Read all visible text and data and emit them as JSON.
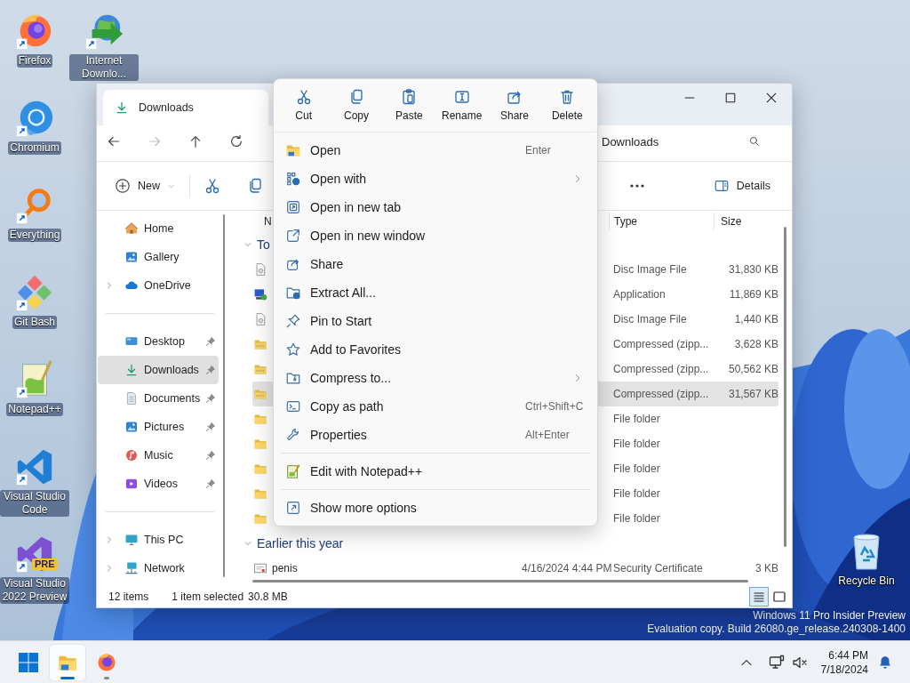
{
  "desktop": {
    "icons": [
      {
        "label": "Firefox"
      },
      {
        "label": "Chromium"
      },
      {
        "label": "Everything"
      },
      {
        "label": "Git Bash"
      },
      {
        "label": "Notepad++"
      },
      {
        "label": "Visual Studio Code"
      },
      {
        "label": "Visual Studio 2022 Preview",
        "badge": "PRE"
      },
      {
        "label": "Internet Downlo..."
      }
    ],
    "recycle_bin": {
      "label": "Recycle Bin"
    },
    "watermark": [
      "Windows 11 Pro Insider Preview",
      "Evaluation copy. Build 26080.ge_release.240308-1400"
    ]
  },
  "explorer": {
    "tab": {
      "title": "Downloads"
    },
    "navigation": [
      {
        "disabled": false
      },
      {
        "disabled": true
      },
      {
        "disabled": false
      },
      {
        "disabled": false
      }
    ],
    "address": "Downloads",
    "toolbar": {
      "new_label": "New",
      "details_label": "Details"
    },
    "sidebar": {
      "sections": [
        [
          {
            "label": "Home",
            "expandable": false,
            "pinned": false,
            "selected": false
          },
          {
            "label": "Gallery",
            "expandable": false,
            "pinned": false,
            "selected": false
          },
          {
            "label": "OneDrive",
            "expandable": true,
            "pinned": false,
            "selected": false
          }
        ],
        [
          {
            "label": "Desktop",
            "expandable": false,
            "pinned": true,
            "selected": false
          },
          {
            "label": "Downloads",
            "expandable": false,
            "pinned": true,
            "selected": true
          },
          {
            "label": "Documents",
            "expandable": false,
            "pinned": true,
            "selected": false
          },
          {
            "label": "Pictures",
            "expandable": false,
            "pinned": true,
            "selected": false
          },
          {
            "label": "Music",
            "expandable": false,
            "pinned": true,
            "selected": false
          },
          {
            "label": "Videos",
            "expandable": false,
            "pinned": true,
            "selected": false
          }
        ],
        [
          {
            "label": "This PC",
            "expandable": true,
            "pinned": false,
            "selected": false
          },
          {
            "label": "Network",
            "expandable": true,
            "pinned": false,
            "selected": false
          }
        ]
      ]
    },
    "columns": [
      {
        "label": "N"
      },
      {
        "label": "Type"
      },
      {
        "label": "Size"
      }
    ],
    "groups": [
      {
        "label": "To",
        "expanded": true,
        "rows": [
          {
            "kind": "iso",
            "type": "Disc Image File",
            "size": "31,830 KB",
            "selected": false
          },
          {
            "kind": "app",
            "type": "Application",
            "size": "11,869 KB",
            "selected": false
          },
          {
            "kind": "iso",
            "type": "Disc Image File",
            "size": "1,440 KB",
            "selected": false
          },
          {
            "kind": "zip",
            "type": "Compressed (zipp...",
            "size": "3,628 KB",
            "selected": false
          },
          {
            "kind": "zip",
            "type": "Compressed (zipp...",
            "size": "50,562 KB",
            "selected": false
          },
          {
            "kind": "zip",
            "type": "Compressed (zipp...",
            "size": "31,567 KB",
            "selected": true
          },
          {
            "kind": "folder",
            "type": "File folder",
            "selected": false
          },
          {
            "kind": "folder",
            "type": "File folder",
            "selected": false
          },
          {
            "kind": "folder",
            "type": "File folder",
            "selected": false
          },
          {
            "kind": "folder",
            "type": "File folder",
            "selected": false
          },
          {
            "kind": "folder",
            "type": "File folder",
            "selected": false
          }
        ]
      },
      {
        "label": "Earlier this year",
        "expanded": true,
        "rows": [
          {
            "kind": "certificate",
            "name": "penis",
            "modified": "4/16/2024 4:44 PM",
            "type": "Security Certificate",
            "size": "3 KB",
            "selected": false
          }
        ]
      }
    ],
    "status_bar": {
      "items": "12 items",
      "selection": "1 item selected",
      "size": "30.8 MB"
    },
    "views": [
      {
        "selected": true
      },
      {
        "selected": false
      }
    ]
  },
  "context_menu": {
    "actions": [
      {
        "label": "Cut"
      },
      {
        "label": "Copy"
      },
      {
        "label": "Paste"
      },
      {
        "label": "Rename"
      },
      {
        "label": "Share"
      },
      {
        "label": "Delete"
      }
    ],
    "groups": [
      [
        {
          "label": "Open",
          "shortcut": "Enter",
          "submenu": false
        },
        {
          "label": "Open with",
          "submenu": true
        },
        {
          "label": "Open in new tab",
          "submenu": false
        },
        {
          "label": "Open in new window",
          "submenu": false
        },
        {
          "label": "Share",
          "submenu": false
        },
        {
          "label": "Extract All...",
          "submenu": false
        },
        {
          "label": "Pin to Start",
          "submenu": false
        },
        {
          "label": "Add to Favorites",
          "submenu": false
        },
        {
          "label": "Compress to...",
          "submenu": true
        },
        {
          "label": "Copy as path",
          "shortcut": "Ctrl+Shift+C",
          "submenu": false
        },
        {
          "label": "Properties",
          "shortcut": "Alt+Enter",
          "submenu": false
        }
      ],
      [
        {
          "label": "Edit with Notepad++",
          "submenu": false
        }
      ],
      [
        {
          "label": "Show more options",
          "submenu": false
        }
      ]
    ]
  },
  "taskbar": {
    "apps": [
      {
        "selected": true,
        "running": true
      },
      {
        "selected": false,
        "running": true
      }
    ],
    "time": "6:44 PM",
    "date": "7/18/2024"
  }
}
